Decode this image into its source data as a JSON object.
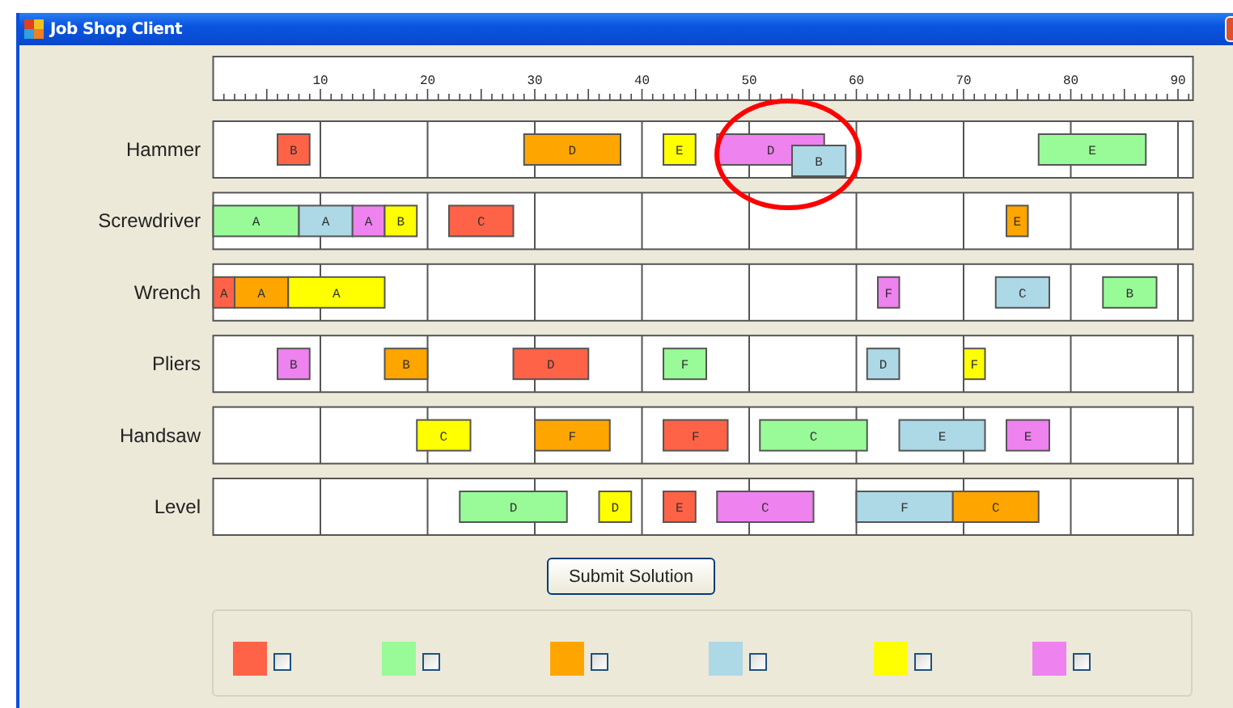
{
  "window": {
    "title": "Job Shop Client"
  },
  "ruler": {
    "ticks": [
      "10",
      "20",
      "30",
      "40",
      "50",
      "60",
      "70",
      "80",
      "90"
    ]
  },
  "machines": [
    {
      "name": "Hammer",
      "tasks": [
        {
          "label": "B",
          "color": "#ff6347"
        },
        {
          "label": "D",
          "color": "#ffa500"
        },
        {
          "label": "E",
          "color": "#ffff00"
        },
        {
          "label": "D",
          "color": "#ee82ee"
        },
        {
          "label": "B",
          "color": "#add8e6"
        },
        {
          "label": "E",
          "color": "#98fb98"
        }
      ]
    },
    {
      "name": "Screwdriver",
      "tasks": [
        {
          "label": "A",
          "color": "#98fb98"
        },
        {
          "label": "A",
          "color": "#add8e6"
        },
        {
          "label": "A",
          "color": "#ee82ee"
        },
        {
          "label": "B",
          "color": "#ffff00"
        },
        {
          "label": "C",
          "color": "#ff6347"
        },
        {
          "label": "E",
          "color": "#ffa500"
        }
      ]
    },
    {
      "name": "Wrench",
      "tasks": [
        {
          "label": "A",
          "color": "#ff6347"
        },
        {
          "label": "A",
          "color": "#ffa500"
        },
        {
          "label": "A",
          "color": "#ffff00"
        },
        {
          "label": "F",
          "color": "#ee82ee"
        },
        {
          "label": "C",
          "color": "#add8e6"
        },
        {
          "label": "B",
          "color": "#98fb98"
        }
      ]
    },
    {
      "name": "Pliers",
      "tasks": [
        {
          "label": "B",
          "color": "#ee82ee"
        },
        {
          "label": "B",
          "color": "#ffa500"
        },
        {
          "label": "D",
          "color": "#ff6347"
        },
        {
          "label": "F",
          "color": "#98fb98"
        },
        {
          "label": "D",
          "color": "#add8e6"
        },
        {
          "label": "F",
          "color": "#ffff00"
        }
      ]
    },
    {
      "name": "Handsaw",
      "tasks": [
        {
          "label": "C",
          "color": "#ffff00"
        },
        {
          "label": "F",
          "color": "#ffa500"
        },
        {
          "label": "F",
          "color": "#ff6347"
        },
        {
          "label": "C",
          "color": "#98fb98"
        },
        {
          "label": "E",
          "color": "#add8e6"
        },
        {
          "label": "E",
          "color": "#ee82ee"
        }
      ]
    },
    {
      "name": "Level",
      "tasks": [
        {
          "label": "D",
          "color": "#98fb98"
        },
        {
          "label": "D",
          "color": "#ffff00"
        },
        {
          "label": "E",
          "color": "#ff6347"
        },
        {
          "label": "C",
          "color": "#ee82ee"
        },
        {
          "label": "F",
          "color": "#add8e6"
        },
        {
          "label": "C",
          "color": "#ffa500"
        }
      ]
    }
  ],
  "submit_button": "Submit Solution",
  "legend": [
    {
      "color": "#ff6347",
      "checked": false
    },
    {
      "color": "#98fb98",
      "checked": false
    },
    {
      "color": "#ffa500",
      "checked": false
    },
    {
      "color": "#add8e6",
      "checked": false
    },
    {
      "color": "#ffff00",
      "checked": false
    },
    {
      "color": "#ee82ee",
      "checked": false
    }
  ]
}
